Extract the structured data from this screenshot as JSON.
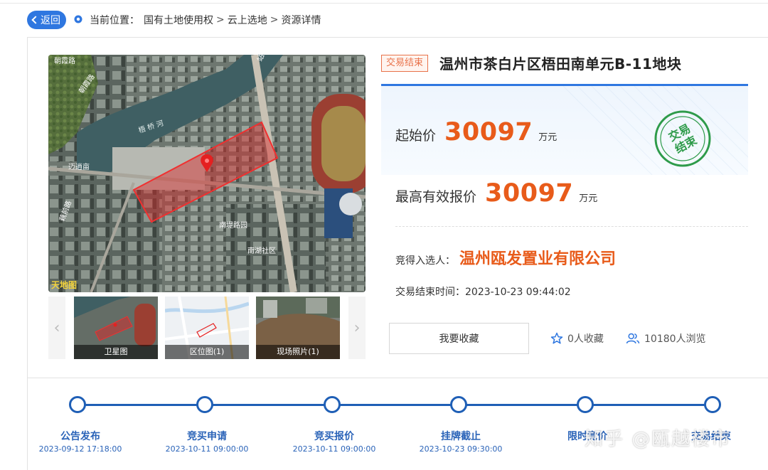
{
  "nav": {
    "back_label": "返回",
    "location_prefix": "当前位置：",
    "breadcrumb": [
      "国有土地使用权",
      "云上选地",
      "资源详情"
    ],
    "separator": ">"
  },
  "gallery": {
    "map_labels": {
      "road_top_left": "朝霞路",
      "road_left": "朝霞路",
      "river": "梧 桥 河",
      "place_left": "迈逍亩",
      "place_lower_left": "藕前路",
      "road_top_right": "站路",
      "community_1": "南堤路园",
      "community_2": "南湖社区",
      "logo": "天地图"
    },
    "thumbnails": [
      {
        "caption": "卫星图"
      },
      {
        "caption": "区位图(1)"
      },
      {
        "caption": "现场照片(1)"
      }
    ],
    "prev_arrow": "‹",
    "next_arrow": "›"
  },
  "detail": {
    "status_tag": "交易结束",
    "title": "温州市茶白片区梧田南单元B-11地块",
    "start_price_label": "起始价",
    "start_price": "30097",
    "start_price_unit": "万元",
    "top_price_label": "最高有效报价",
    "top_price": "30097",
    "top_price_unit": "万元",
    "stamp_line1": "交易",
    "stamp_line2": "结束",
    "winner_label": "竞得入选人：",
    "winner": "温州瓯发置业有限公司",
    "end_time_label": "交易结束时间：",
    "end_time": "2023-10-23 09:44:02",
    "favorite_button": "我要收藏",
    "favorites": "0人收藏",
    "views": "10180人浏览"
  },
  "timeline": [
    {
      "label": "公告发布",
      "date": "2023-09-12 17:18:00"
    },
    {
      "label": "竞买申请",
      "date": "2023-10-11 09:00:00"
    },
    {
      "label": "竞买报价",
      "date": "2023-10-11 09:00:00"
    },
    {
      "label": "挂牌截止",
      "date": "2023-10-23 09:30:00"
    },
    {
      "label": "限时竞价",
      "date": ""
    },
    {
      "label": "交易结束",
      "date": ""
    }
  ],
  "watermark": "知乎 @瓯越楼市",
  "colors": {
    "accent_blue": "#2f77e0",
    "price_orange": "#e85b1a",
    "stamp_green": "#2e9b4a",
    "timeline_blue": "#1f5fb6"
  }
}
